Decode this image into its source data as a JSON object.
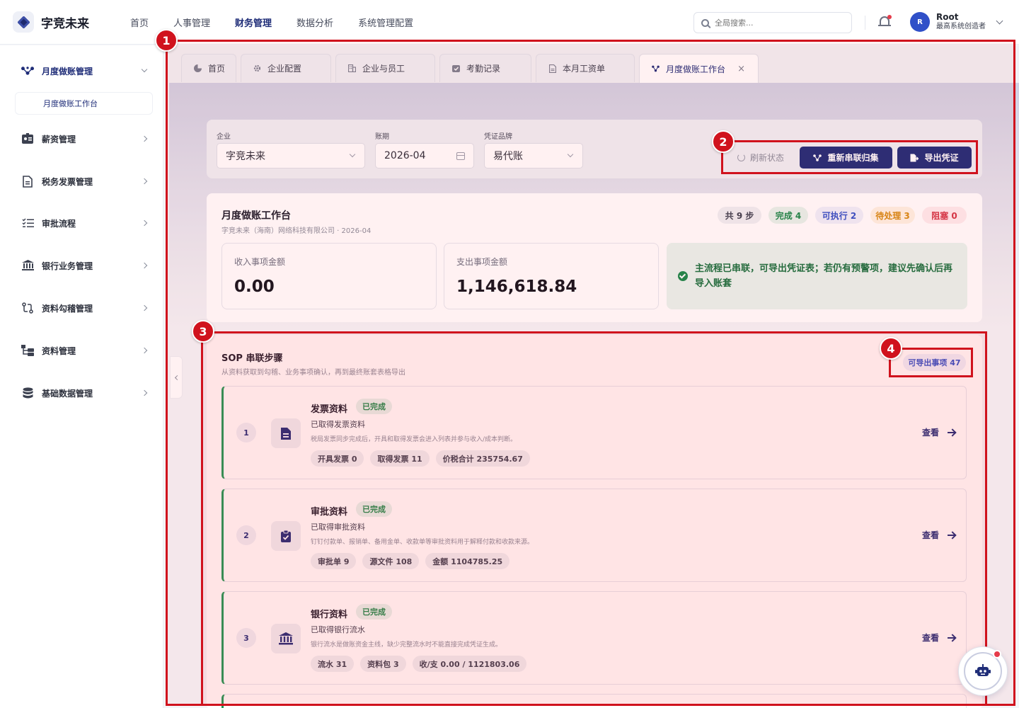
{
  "app": {
    "logo_text": "字竞未来"
  },
  "topnav": [
    {
      "label": "首页",
      "active": false
    },
    {
      "label": "人事管理",
      "active": false
    },
    {
      "label": "财务管理",
      "active": true
    },
    {
      "label": "数据分析",
      "active": false
    },
    {
      "label": "系统管理配置",
      "active": false
    }
  ],
  "search": {
    "placeholder": "全局搜索..."
  },
  "user": {
    "initial": "R",
    "name": "Root",
    "role": "最高系统创造者"
  },
  "sidebar": {
    "groups": [
      {
        "label": "月度做账管理",
        "icon": "nodes-icon",
        "expanded": true
      },
      {
        "label": "薪资管理",
        "icon": "id-card-icon"
      },
      {
        "label": "税务发票管理",
        "icon": "document-icon"
      },
      {
        "label": "审批流程",
        "icon": "list-check-icon"
      },
      {
        "label": "银行业务管理",
        "icon": "bank-icon"
      },
      {
        "label": "资料勾稽管理",
        "icon": "link-icon"
      },
      {
        "label": "资料管理",
        "icon": "folder-tree-icon"
      },
      {
        "label": "基础数据管理",
        "icon": "database-icon"
      }
    ],
    "sub_item": "月度做账工作台"
  },
  "tabs": [
    {
      "label": "首页",
      "icon": "pie-icon"
    },
    {
      "label": "企业配置",
      "icon": "gear-icon"
    },
    {
      "label": "企业与员工",
      "icon": "building-icon"
    },
    {
      "label": "考勤记录",
      "icon": "check-icon"
    },
    {
      "label": "本月工资单",
      "icon": "doc-icon"
    },
    {
      "label": "月度做账工作台",
      "icon": "nodes-icon",
      "active": true
    }
  ],
  "filters": {
    "company_label": "企业",
    "company_value": "字竞未来",
    "period_label": "账期",
    "period_value": "2026-04",
    "brand_label": "凭证品牌",
    "brand_value": "易代账",
    "refresh_label": "刷新状态",
    "rebuild_label": "重新串联归集",
    "export_label": "导出凭证"
  },
  "summary": {
    "title": "月度做账工作台",
    "subtitle": "字竞未来（海南）网络科技有限公司 · 2026-04",
    "pills": {
      "total": "共 9 步",
      "done": "完成 4",
      "runnable": "可执行 2",
      "pending": "待处理 3",
      "blocked": "阻塞 0"
    },
    "income_label": "收入事项金额",
    "income_value": "0.00",
    "expense_label": "支出事项金额",
    "expense_value": "1,146,618.84",
    "notice": "主流程已串联，可导出凭证表；若仍有预警项，建议先确认后再导入账套"
  },
  "sop": {
    "title": "SOP 串联步骤",
    "subtitle": "从资料获取到勾稽、业务事项确认，再到最终账套表格导出",
    "export_count": "可导出事项 47",
    "view_label": "查看",
    "steps": [
      {
        "num": "1",
        "title": "发票资料",
        "status": "已完成",
        "desc": "已取得发票资料",
        "note": "税局发票同步完成后，开具和取得发票会进入列表并参与收入/成本判断。",
        "chips": [
          "开具发票 0",
          "取得发票 11",
          "价税合计 235754.67"
        ]
      },
      {
        "num": "2",
        "title": "审批资料",
        "status": "已完成",
        "desc": "已取得审批资料",
        "note": "钉钉付款单、报销单、备用金单、收款单等审批资料用于解释付款和收款来源。",
        "chips": [
          "审批单 9",
          "源文件 108",
          "金额 1104785.25"
        ]
      },
      {
        "num": "3",
        "title": "银行资料",
        "status": "已完成",
        "desc": "已取得银行流水",
        "note": "银行流水是做账资金主线，缺少完整流水时不能直接完成凭证生成。",
        "chips": [
          "流水 31",
          "资料包 3",
          "收/支 0.00 / 1121803.06"
        ]
      }
    ]
  },
  "annotations": [
    "1",
    "2",
    "3",
    "4"
  ],
  "colors": {
    "brand": "#1f2d78",
    "success": "#17894a",
    "annotation": "#d0121d"
  }
}
